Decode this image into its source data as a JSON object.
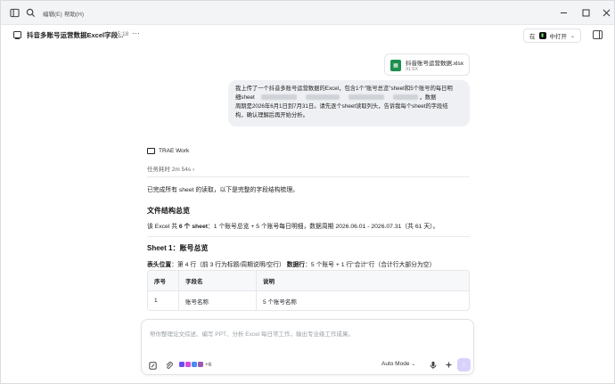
{
  "titlebar": {
    "menu": [
      "编辑(E)",
      "帮助(H)"
    ]
  },
  "header": {
    "title": "抖音多账号运营数据Excel字段...",
    "time": "15:18",
    "open_in_prefix": "在",
    "open_in_label": "中打开"
  },
  "attachment": {
    "name": "抖音账号运营数据.xlsx",
    "type": "XLSX"
  },
  "user_message": {
    "line1": "我上传了一个抖音多账号运营数据的Excel，包含1个\"账号总览\"sheet和5个账号的每日明",
    "line2_a": "细sheet",
    "line2_b": "，数据",
    "line3": "周期是2026年6月1日到7月31日。请先逐个sheet读取列头，告诉我每个sheet的字段结",
    "line4": "构，确认理解后再开始分析。"
  },
  "assistant": {
    "name": "TRAE Work",
    "elapsed": "任务耗时 2m 54s",
    "intro": "已完成所有 sheet 的读取，以下是完整的字段结构梳理。",
    "h_overview": "文件结构总览",
    "overview_a": "该 Excel 共 ",
    "overview_b": "6 个 sheet",
    "overview_c": "：1 个账号总览 + 5 个账号每日明细，数据周期 2026.06.01 - 2026.07.31（共 61 天）。",
    "h_sheet1": "Sheet 1：账号总览",
    "hdr_pos_label": "表头位置",
    "hdr_pos_val": "：第 4 行（前 3 行为标题/周期说明/空行）",
    "data_rows_label": "数据行",
    "data_rows_val": "：5 个账号 + 1 行\"合计\"行（合计行大部分为空）"
  },
  "table": {
    "headers": [
      "序号",
      "字段名",
      "说明"
    ],
    "rows": [
      [
        "1",
        "账号名称",
        "5 个账号名称"
      ]
    ]
  },
  "composer": {
    "placeholder": "帮你整理论文综述、编写 PPT、分析 Excel 每日常工作，输出专业级工作成果。",
    "extra_count": "+6",
    "mode": "Auto Mode"
  }
}
